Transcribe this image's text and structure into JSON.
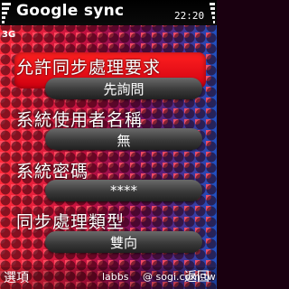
{
  "status": {
    "title": "Google sync",
    "network": "3G",
    "time": "22:20"
  },
  "settings": [
    {
      "label": "允許同步處理要求",
      "value": "先詢問"
    },
    {
      "label": "系統使用者名稱",
      "value": "無"
    },
    {
      "label": "系統密碼",
      "value": "****"
    },
    {
      "label": "同步處理類型",
      "value": "雙向"
    }
  ],
  "softkeys": {
    "left": "選項",
    "middle": "labbs",
    "right": "返回"
  },
  "watermark": "@ sogi.com.tw",
  "colors": {
    "highlight": "#ff2020",
    "background_left": "#ff2a3a",
    "background_right": "#2050c0"
  }
}
